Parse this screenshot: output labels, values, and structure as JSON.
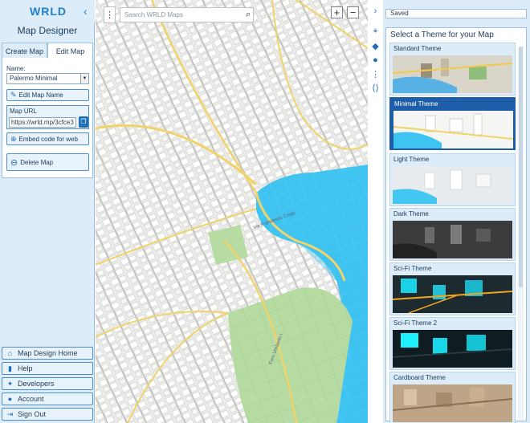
{
  "app": {
    "logo": "WRLD",
    "title": "Map Designer"
  },
  "tabs": {
    "create": "Create Map",
    "edit": "Edit Map"
  },
  "form": {
    "name_label": "Name:",
    "name_value": "Palermo Minimal",
    "edit_name_button": "Edit Map Name",
    "url_label": "Map URL",
    "url_value": "https://wrld.mp/3cfce3",
    "embed_button": "Embed code for web",
    "delete_button": "Delete Map"
  },
  "bottom_nav": [
    {
      "label": "Map Design Home",
      "icon": "home-icon"
    },
    {
      "label": "Help",
      "icon": "help-icon"
    },
    {
      "label": "Developers",
      "icon": "wrench-icon"
    },
    {
      "label": "Account",
      "icon": "user-icon"
    },
    {
      "label": "Sign Out",
      "icon": "signout-icon"
    }
  ],
  "map": {
    "search_placeholder": "Search WRLD Maps",
    "zoom_in": "+",
    "zoom_out": "−",
    "street_labels": [
      "Via Francesco Crispi",
      "Foro Umberto I"
    ]
  },
  "status": {
    "saved": "Saved"
  },
  "themes": {
    "heading": "Select a Theme for your Map",
    "items": [
      {
        "name": "Standard Theme",
        "selected": false
      },
      {
        "name": "Minimal Theme",
        "selected": true
      },
      {
        "name": "Light Theme",
        "selected": false
      },
      {
        "name": "Dark Theme",
        "selected": false
      },
      {
        "name": "Sci-Fi Theme",
        "selected": false
      },
      {
        "name": "Sci-Fi Theme 2",
        "selected": false
      },
      {
        "name": "Cardboard Theme",
        "selected": false
      }
    ]
  },
  "colors": {
    "accent": "#1e6fb8",
    "panel_bg": "#dcecf8",
    "selected_theme": "#1e5ea9",
    "water": "#3fc3f0",
    "park": "#b7dca3",
    "road": "#f1d36b"
  }
}
